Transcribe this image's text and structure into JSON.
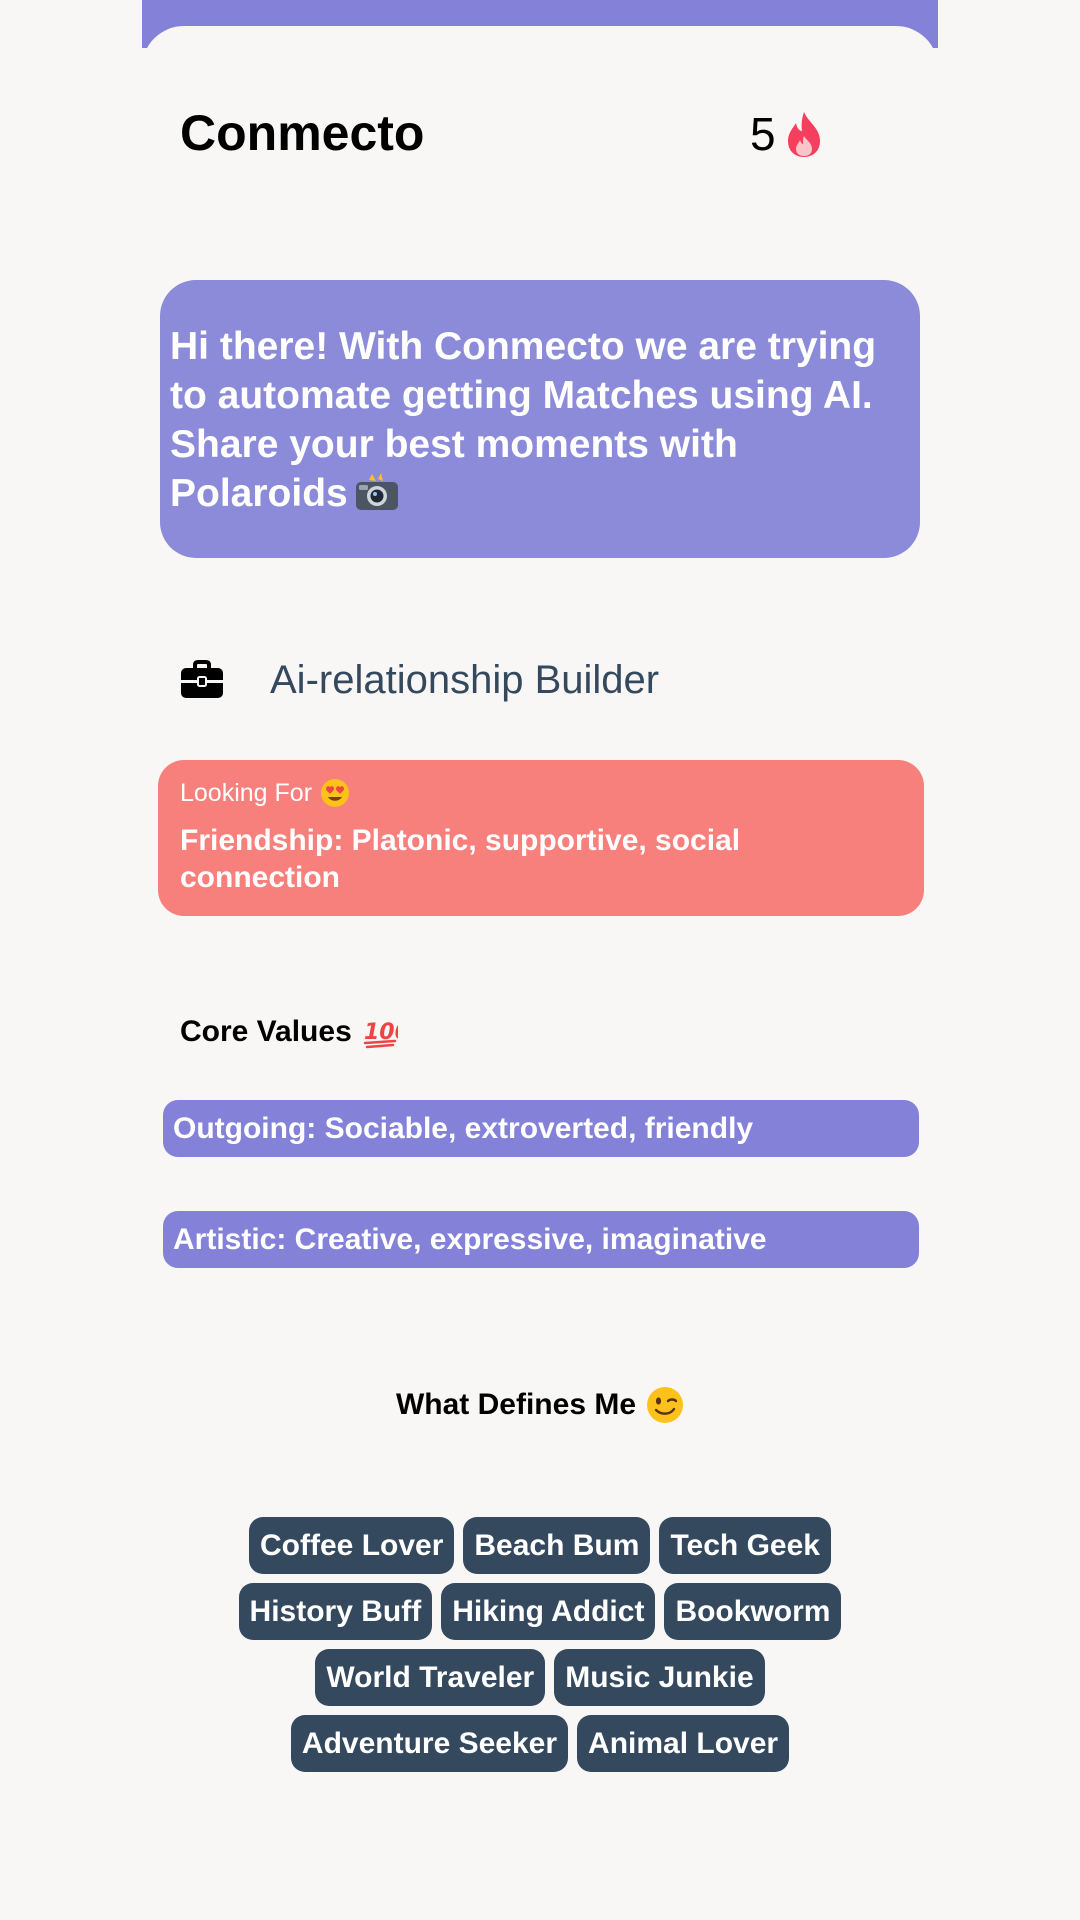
{
  "header": {
    "app_title": "Conmecto",
    "streak_count": "5",
    "streak_icon": "flame-icon",
    "accent": "#8481d8"
  },
  "intro": {
    "text": "Hi there! With Conmecto we are trying to automate getting Matches using AI. Share your best moments with Polaroids",
    "icon": "camera-flash-icon",
    "background": "#8b8bd9"
  },
  "builder": {
    "icon": "briefcase-icon",
    "title": "Ai-relationship Builder"
  },
  "looking_for": {
    "label": "Looking For",
    "icon": "heart-eyes-icon",
    "value": "Friendship: Platonic, supportive, social connection",
    "background": "#f77f7c"
  },
  "core_values": {
    "title": "Core Values",
    "icon": "hundred-points-icon",
    "items": [
      "Outgoing: Sociable, extroverted, friendly",
      "Artistic: Creative, expressive, imaginative"
    ]
  },
  "defines_me": {
    "title": "What Defines Me",
    "icon": "winking-face-icon",
    "tags": [
      "Coffee Lover",
      "Beach Bum",
      "Tech Geek",
      "History Buff",
      "Hiking Addict",
      "Bookworm",
      "World Traveler",
      "Music Junkie",
      "Adventure Seeker",
      "Animal Lover"
    ],
    "tag_color": "#34495e"
  }
}
